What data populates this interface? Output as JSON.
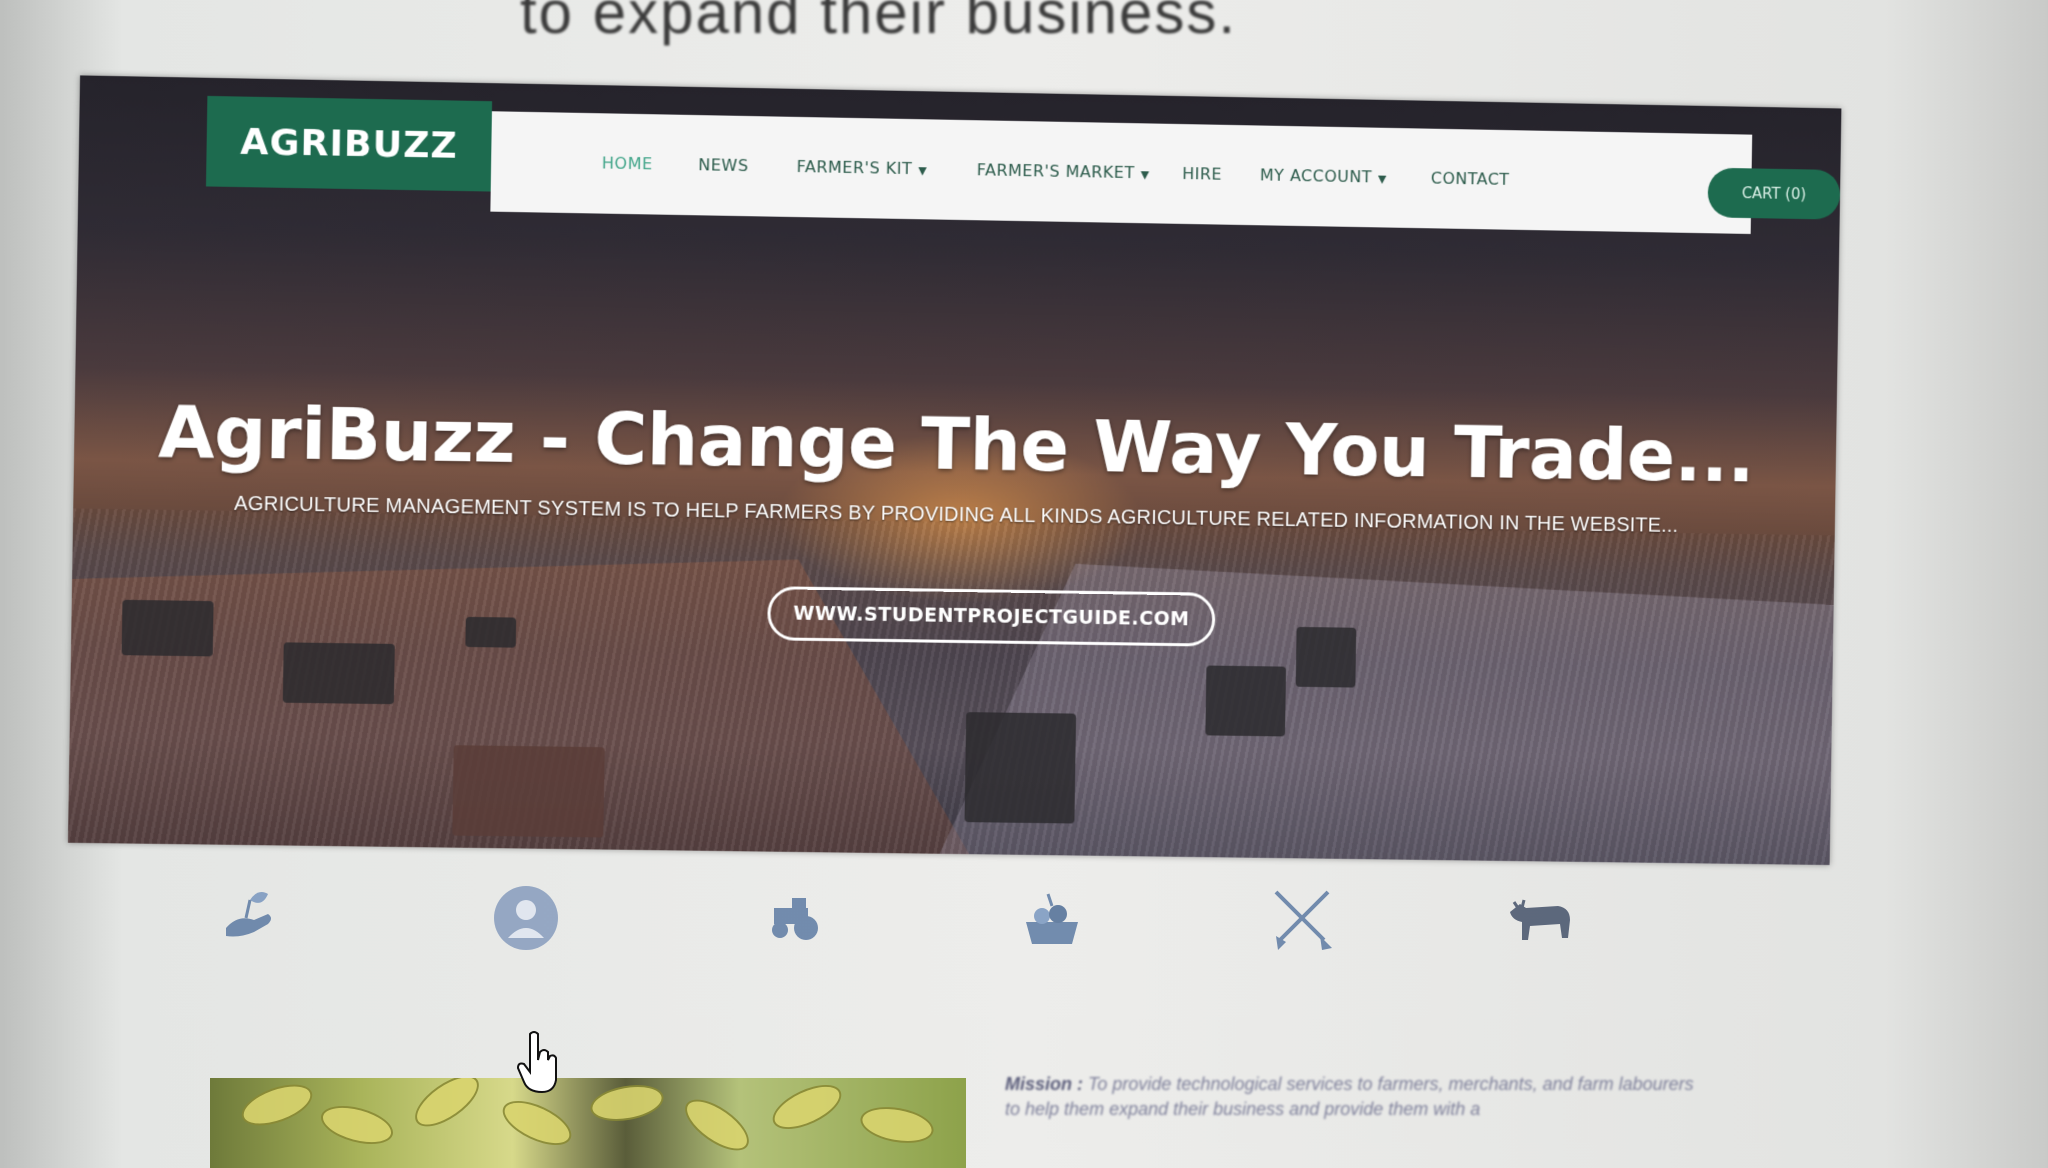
{
  "background_caption": {
    "text": "to expand their business."
  },
  "site": {
    "logo": "AGRIBUZZ",
    "nav": [
      {
        "label": "HOME",
        "active": true,
        "dropdown": false
      },
      {
        "label": "NEWS",
        "active": false,
        "dropdown": false
      },
      {
        "label": "FARMER'S KIT",
        "active": false,
        "dropdown": true
      },
      {
        "label": "FARMER'S MARKET",
        "active": false,
        "dropdown": true
      },
      {
        "label": "HIRE",
        "active": false,
        "dropdown": false
      },
      {
        "label": "MY ACCOUNT",
        "active": false,
        "dropdown": true
      },
      {
        "label": "CONTACT",
        "active": false,
        "dropdown": false
      }
    ],
    "cart_label": "CART (0)",
    "hero": {
      "title": "AgriBuzz - Change The Way You Trade...",
      "subtitle": "AGRICULTURE MANAGEMENT SYSTEM IS TO HELP FARMERS BY PROVIDING ALL KINDS AGRICULTURE RELATED INFORMATION IN THE WEBSITE...",
      "button_label": "WWW.STUDENTPROJECTGUIDE.COM"
    },
    "feature_icons": [
      "farming-hand-icon",
      "farmer-avatar-icon",
      "tractor-icon",
      "harvest-basket-icon",
      "crossed-tools-icon",
      "bull-icon"
    ],
    "mission": {
      "label": "Mission :",
      "text": "To provide technological services to farmers, merchants, and farm labourers to help them expand their business and provide them with a"
    }
  },
  "colors": {
    "brand_green": "#1d6b4f",
    "nav_text": "#2d5c4c",
    "nav_active": "#3fa488",
    "icon_color": "#4a6c9a"
  }
}
